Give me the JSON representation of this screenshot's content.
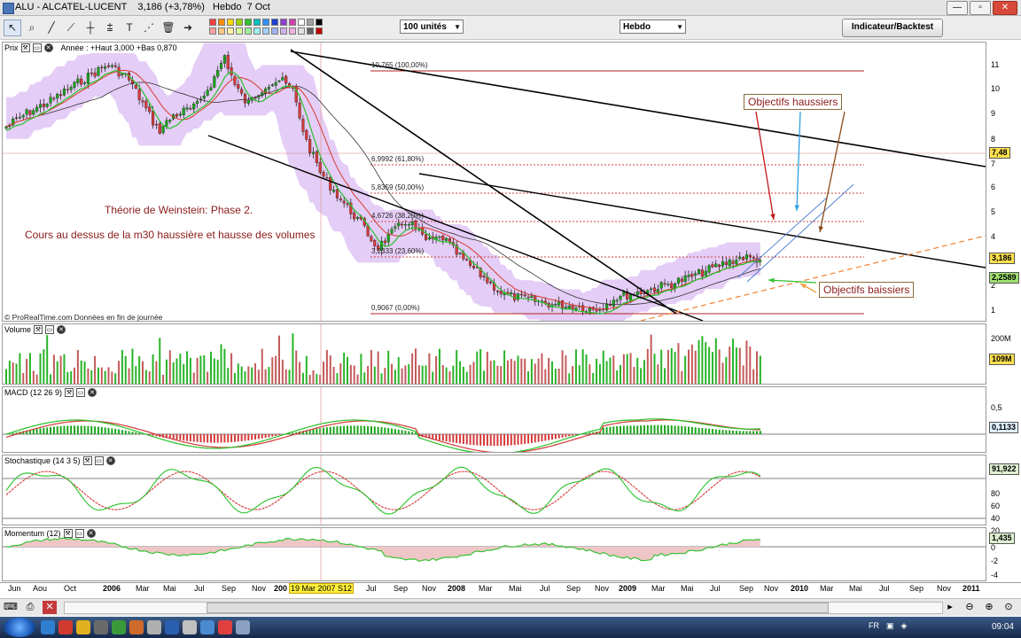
{
  "window": {
    "title": "ALU - ALCATEL-LUCENT    3,186 (+3,78%)   Hebdo  7 Oct"
  },
  "toolbar": {
    "units_select": "100 unités",
    "period_select": "Hebdo",
    "indicator_button": "Indicateur/Backtest",
    "palette": [
      "#ff4040",
      "#ff8c00",
      "#ffd800",
      "#9bd400",
      "#2fbf2f",
      "#00c0c0",
      "#2f8fff",
      "#1f3fd0",
      "#8f3fd0",
      "#d03fb0",
      "#ffffff",
      "#a0a0a0",
      "#000000",
      "#ffa0a0",
      "#ffc880",
      "#fff0a0",
      "#d8ff9a",
      "#a0f0a0",
      "#a0f0f0",
      "#a0d0ff",
      "#a0b0f0",
      "#d0b0f0",
      "#f0b0e0",
      "#e0e0e0",
      "#606060",
      "#c00000"
    ]
  },
  "price_panel": {
    "label": "Prix",
    "legend": "Année : +Haut 3,000 +Bas 0,870",
    "copyright": "© ProRealTime.com Données en fin de journée",
    "fib_levels": [
      {
        "label": "10,765 (100,00%)",
        "color": "#b22222",
        "dotted": false
      },
      {
        "label": "6,9992 (61,80%)",
        "color": "#d04040",
        "dotted": true
      },
      {
        "label": "5,8359 (50,00%)",
        "color": "#d04040",
        "dotted": true
      },
      {
        "label": "4,6726 (38,20%)",
        "color": "#d04040",
        "dotted": true
      },
      {
        "label": "3,2333 (23,60%)",
        "color": "#d04040",
        "dotted": true
      },
      {
        "label": "0,9067 (0,00%)",
        "color": "#b22222",
        "dotted": false
      }
    ],
    "y_ticks": [
      "11",
      "10",
      "9",
      "8",
      "7",
      "6",
      "5",
      "4",
      "3",
      "2",
      "1"
    ],
    "tags": [
      {
        "text": "7,48",
        "bg": "#ffe14d"
      },
      {
        "text": "3,186",
        "bg": "#ffe14d"
      },
      {
        "text": "2,2589",
        "bg": "#9fe06f"
      }
    ],
    "annotations": {
      "theory": "Théorie de Weinstein: Phase 2.",
      "course": "Cours au dessus de la m30 haussière et hausse des volumes",
      "obj_up": "Objectifs haussiers",
      "obj_down": "Objectifs baissiers"
    }
  },
  "volume_panel": {
    "label": "Volume",
    "ticks": [
      "200M"
    ],
    "tag": "109M"
  },
  "macd_panel": {
    "label": "MACD (12 26 9)",
    "ticks": [
      "0,5"
    ],
    "tag": "0,1133"
  },
  "stoch_panel": {
    "label": "Stochastique (14 3 5)",
    "ticks": [
      "80",
      "60",
      "40",
      "20"
    ],
    "tag": "91,922"
  },
  "momentum_panel": {
    "label": "Momentum (12)",
    "ticks": [
      "0",
      "-2",
      "-4"
    ],
    "tag": "1,435"
  },
  "xaxis": {
    "labels": [
      "Jun",
      "Aou",
      "Oct",
      "2006",
      "Mar",
      "Mai",
      "Jul",
      "Sep",
      "Nov",
      "200",
      "Jul",
      "Sep",
      "Nov",
      "2008",
      "Mar",
      "Mai",
      "Jul",
      "Sep",
      "Nov",
      "2009",
      "Mar",
      "Mai",
      "Jul",
      "Sep",
      "Nov",
      "2010",
      "Mar",
      "Mai",
      "Jul",
      "Sep",
      "Nov",
      "2011"
    ],
    "highlight": "19 Mar 2007 S12"
  },
  "statusbar": {
    "tray_lang": "FR",
    "clock": "09:04"
  },
  "colors": {
    "bull": "#1aa51a",
    "bear": "#d43a3a",
    "band": "#e4cdf6",
    "ma_red": "#d63b2b",
    "ma_green": "#27c227",
    "volume_green": "#28b428",
    "volume_red": "#c45a5a"
  }
}
